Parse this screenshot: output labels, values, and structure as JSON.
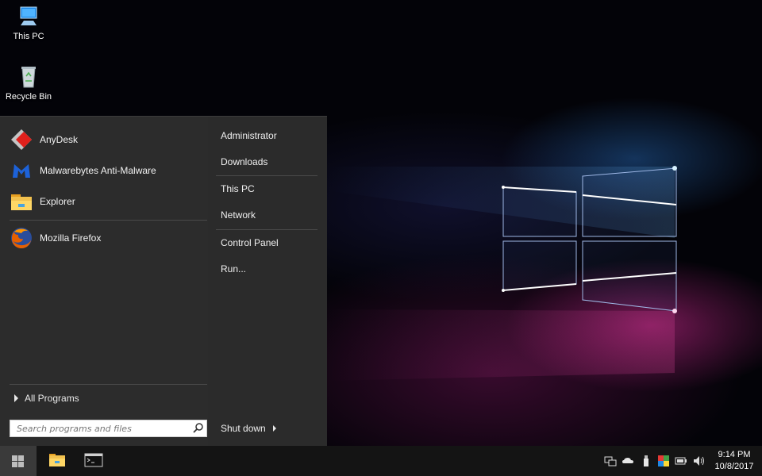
{
  "desktop": {
    "icons": [
      {
        "label": "This PC",
        "icon": "this-pc-icon"
      },
      {
        "label": "Recycle Bin",
        "icon": "recycle-bin-icon"
      }
    ]
  },
  "start_menu": {
    "programs": [
      {
        "label": "AnyDesk",
        "icon": "anydesk-icon"
      },
      {
        "label": "Malwarebytes Anti-Malware",
        "icon": "malwarebytes-icon"
      },
      {
        "label": "Explorer",
        "icon": "folder-icon"
      },
      {
        "label": "Mozilla Firefox",
        "icon": "firefox-icon"
      }
    ],
    "all_programs_label": "All Programs",
    "search": {
      "placeholder": "Search programs and files"
    },
    "places": [
      {
        "label": "Administrator"
      },
      {
        "label": "Downloads"
      },
      {
        "label": "This PC"
      },
      {
        "label": "Network"
      },
      {
        "label": "Control Panel"
      },
      {
        "label": "Run..."
      }
    ],
    "shutdown_label": "Shut down"
  },
  "taskbar": {
    "pinned": [
      {
        "icon": "file-explorer-icon"
      },
      {
        "icon": "command-prompt-icon"
      }
    ],
    "tray_icons": [
      "network-icon",
      "cloud-icon",
      "usb-drive-icon",
      "color-icon",
      "battery-icon",
      "volume-icon"
    ],
    "clock": {
      "time": "9:14 PM",
      "date": "10/8/2017"
    }
  },
  "colors": {
    "start_menu_bg": "#2b2b2b",
    "taskbar_bg": "#141414",
    "anydesk_red": "#e0201c",
    "malwarebytes_blue": "#1d62d8"
  }
}
